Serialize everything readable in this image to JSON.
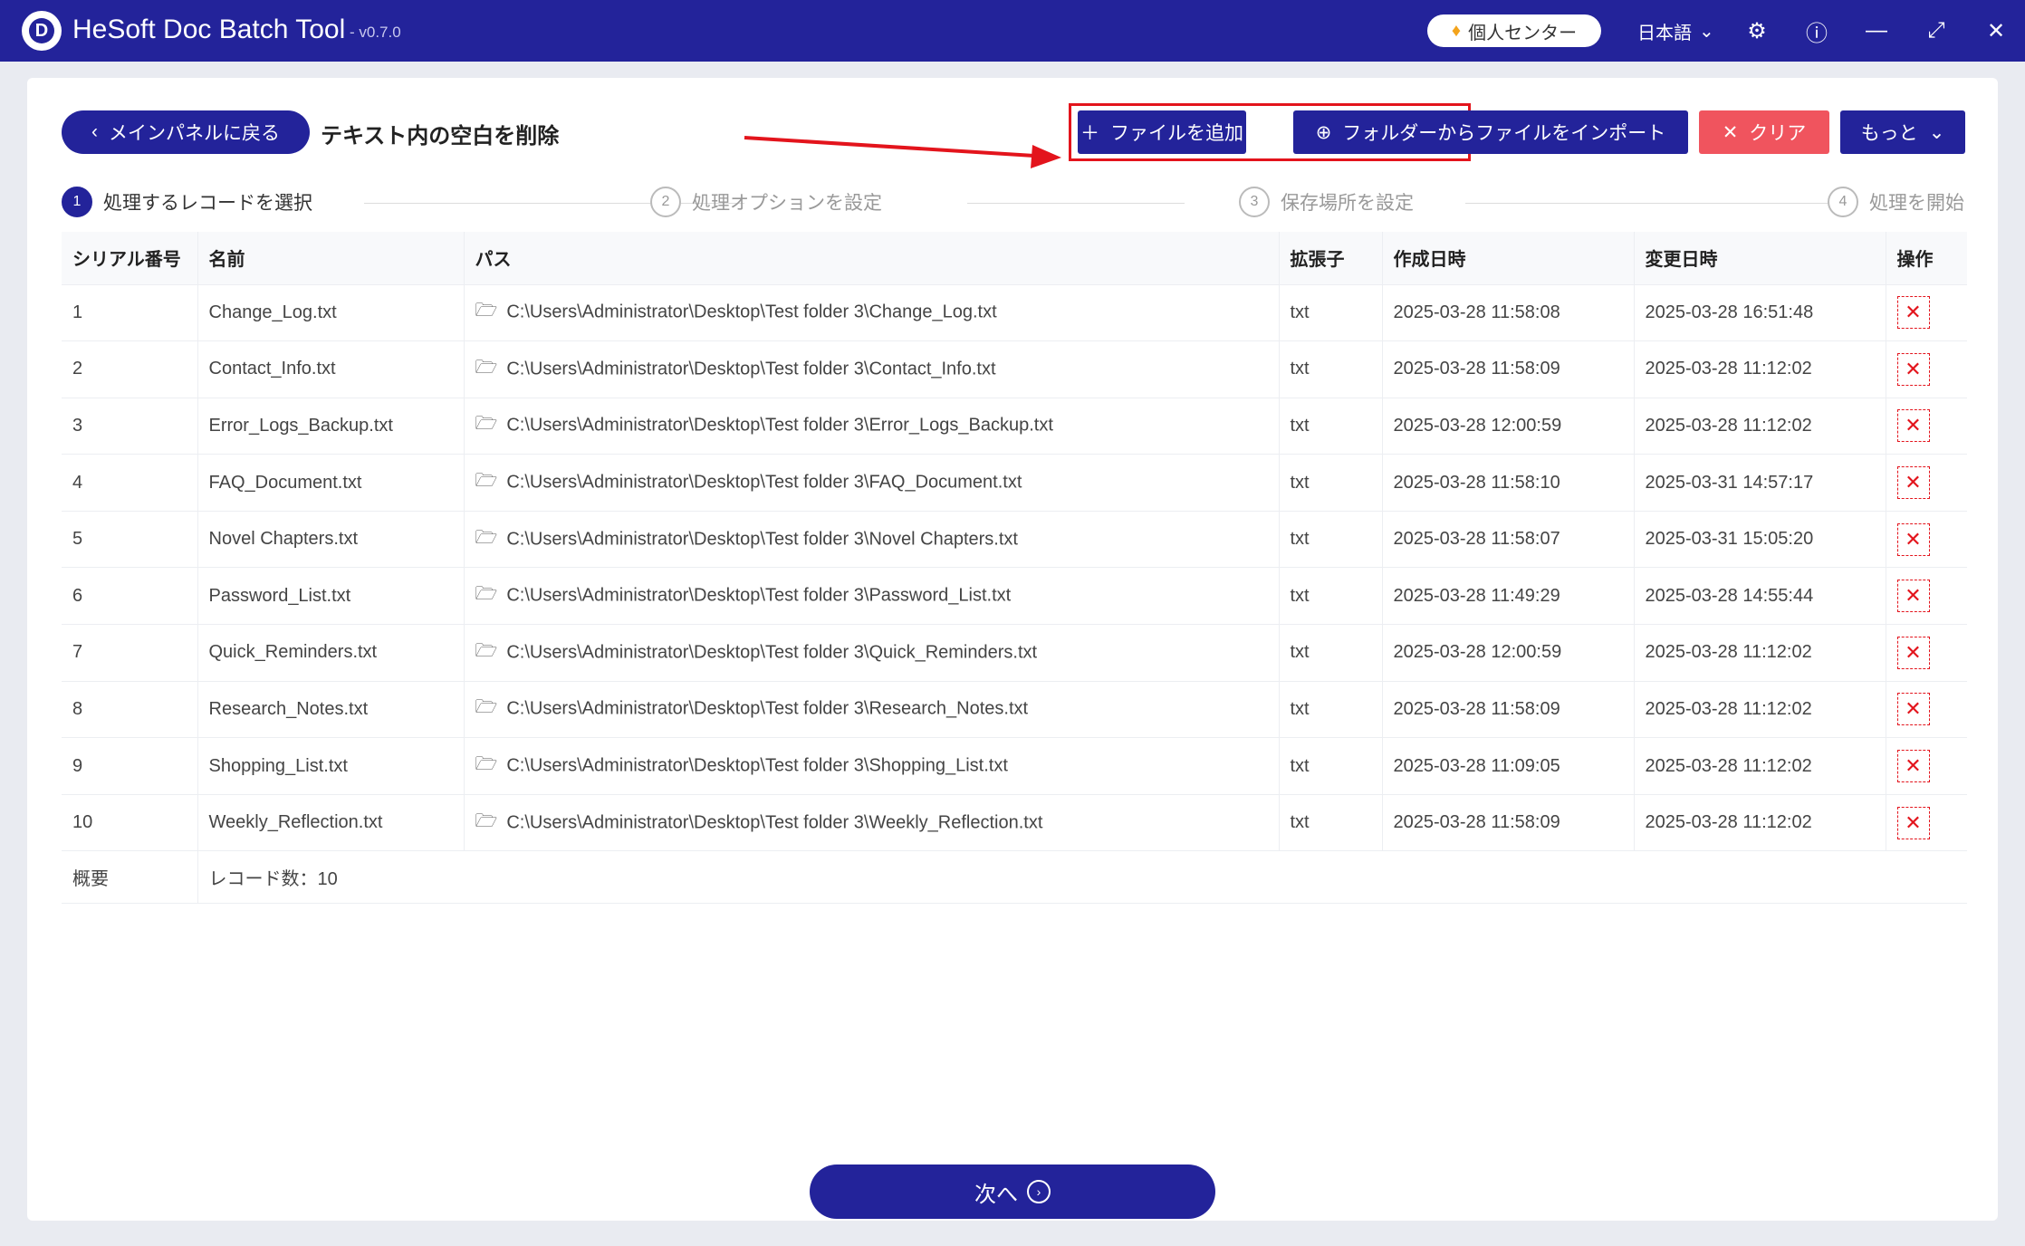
{
  "titlebar": {
    "app_title": "HeSoft Doc Batch Tool",
    "version": "- v0.7.0",
    "profile_label": "個人センター",
    "language": "日本語"
  },
  "toolbar": {
    "back_label": "メインパネルに戻る",
    "page_title": "テキスト内の空白を削除",
    "add_file_label": "ファイルを追加",
    "import_folder_label": "フォルダーからファイルをインポート",
    "clear_label": "クリア",
    "more_label": "もっと"
  },
  "steps": [
    {
      "num": "1",
      "label": "処理するレコードを選択"
    },
    {
      "num": "2",
      "label": "処理オプションを設定"
    },
    {
      "num": "3",
      "label": "保存場所を設定"
    },
    {
      "num": "4",
      "label": "処理を開始"
    }
  ],
  "table": {
    "headers": {
      "serial": "シリアル番号",
      "name": "名前",
      "path": "パス",
      "ext": "拡張子",
      "created": "作成日時",
      "modified": "変更日時",
      "op": "操作"
    },
    "rows": [
      {
        "serial": "1",
        "name": "Change_Log.txt",
        "path": "C:\\Users\\Administrator\\Desktop\\Test folder 3\\Change_Log.txt",
        "ext": "txt",
        "created": "2025-03-28 11:58:08",
        "modified": "2025-03-28 16:51:48"
      },
      {
        "serial": "2",
        "name": "Contact_Info.txt",
        "path": "C:\\Users\\Administrator\\Desktop\\Test folder 3\\Contact_Info.txt",
        "ext": "txt",
        "created": "2025-03-28 11:58:09",
        "modified": "2025-03-28 11:12:02"
      },
      {
        "serial": "3",
        "name": "Error_Logs_Backup.txt",
        "path": "C:\\Users\\Administrator\\Desktop\\Test folder 3\\Error_Logs_Backup.txt",
        "ext": "txt",
        "created": "2025-03-28 12:00:59",
        "modified": "2025-03-28 11:12:02"
      },
      {
        "serial": "4",
        "name": "FAQ_Document.txt",
        "path": "C:\\Users\\Administrator\\Desktop\\Test folder 3\\FAQ_Document.txt",
        "ext": "txt",
        "created": "2025-03-28 11:58:10",
        "modified": "2025-03-31 14:57:17"
      },
      {
        "serial": "5",
        "name": "Novel Chapters.txt",
        "path": "C:\\Users\\Administrator\\Desktop\\Test folder 3\\Novel Chapters.txt",
        "ext": "txt",
        "created": "2025-03-28 11:58:07",
        "modified": "2025-03-31 15:05:20"
      },
      {
        "serial": "6",
        "name": "Password_List.txt",
        "path": "C:\\Users\\Administrator\\Desktop\\Test folder 3\\Password_List.txt",
        "ext": "txt",
        "created": "2025-03-28 11:49:29",
        "modified": "2025-03-28 14:55:44"
      },
      {
        "serial": "7",
        "name": "Quick_Reminders.txt",
        "path": "C:\\Users\\Administrator\\Desktop\\Test folder 3\\Quick_Reminders.txt",
        "ext": "txt",
        "created": "2025-03-28 12:00:59",
        "modified": "2025-03-28 11:12:02"
      },
      {
        "serial": "8",
        "name": "Research_Notes.txt",
        "path": "C:\\Users\\Administrator\\Desktop\\Test folder 3\\Research_Notes.txt",
        "ext": "txt",
        "created": "2025-03-28 11:58:09",
        "modified": "2025-03-28 11:12:02"
      },
      {
        "serial": "9",
        "name": "Shopping_List.txt",
        "path": "C:\\Users\\Administrator\\Desktop\\Test folder 3\\Shopping_List.txt",
        "ext": "txt",
        "created": "2025-03-28 11:09:05",
        "modified": "2025-03-28 11:12:02"
      },
      {
        "serial": "10",
        "name": "Weekly_Reflection.txt",
        "path": "C:\\Users\\Administrator\\Desktop\\Test folder 3\\Weekly_Reflection.txt",
        "ext": "txt",
        "created": "2025-03-28 11:58:09",
        "modified": "2025-03-28 11:12:02"
      }
    ],
    "summary_label": "概要",
    "summary_value": "レコード数：10"
  },
  "footer": {
    "next_label": "次へ"
  },
  "colors": {
    "primary": "#23239a",
    "danger": "#f0545e",
    "highlight": "#e3141c"
  }
}
